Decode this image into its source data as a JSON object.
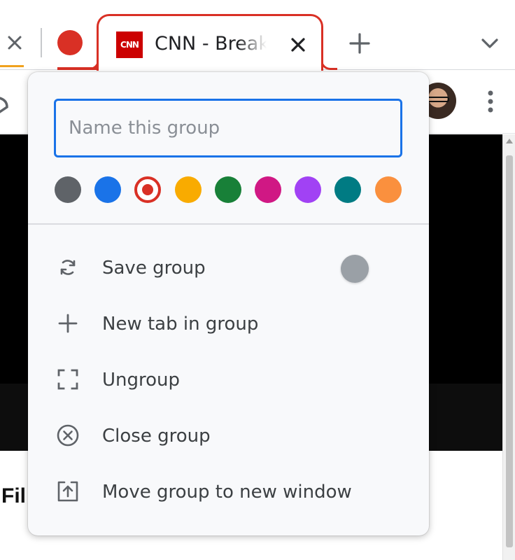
{
  "tabstrip": {
    "active_tab": {
      "favicon_text": "CNN",
      "favicon_color": "#cc0000",
      "title": "CNN - Breaking News, Latest News and Videos"
    },
    "group_color": "#d93025",
    "new_tab_symbol": "+"
  },
  "group_editor": {
    "name_input": {
      "value": "",
      "placeholder": "Name this group"
    },
    "colors": [
      {
        "name": "grey",
        "hex": "#5f6368",
        "selected": false
      },
      {
        "name": "blue",
        "hex": "#1a73e8",
        "selected": false
      },
      {
        "name": "red",
        "hex": "#d93025",
        "selected": true
      },
      {
        "name": "yellow",
        "hex": "#f9ab00",
        "selected": false
      },
      {
        "name": "green",
        "hex": "#188038",
        "selected": false
      },
      {
        "name": "pink",
        "hex": "#d01884",
        "selected": false
      },
      {
        "name": "purple",
        "hex": "#a142f4",
        "selected": false
      },
      {
        "name": "cyan",
        "hex": "#007b83",
        "selected": false
      },
      {
        "name": "orange",
        "hex": "#fa903e",
        "selected": false
      }
    ],
    "menu": [
      {
        "label": "Save group",
        "icon": "sync-icon",
        "toggle": false
      },
      {
        "label": "New tab in group",
        "icon": "plus-icon"
      },
      {
        "label": "Ungroup",
        "icon": "ungroup-icon"
      },
      {
        "label": "Close group",
        "icon": "close-circle-icon"
      },
      {
        "label": "Move group to new window",
        "icon": "move-window-icon"
      }
    ]
  },
  "page": {
    "partial_text": "Fil"
  }
}
